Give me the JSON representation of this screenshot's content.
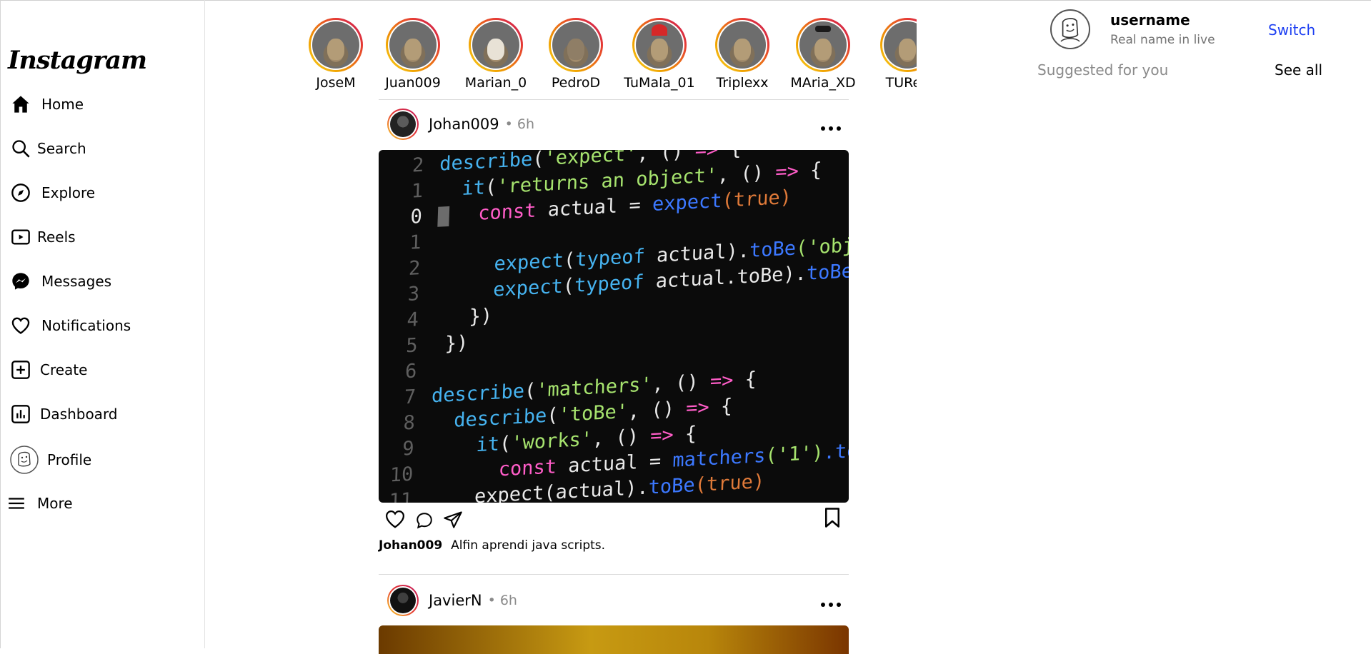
{
  "brand": {
    "logo": "Instagram"
  },
  "sidebar": {
    "items": [
      {
        "label": "Home",
        "icon": "home-icon"
      },
      {
        "label": "Search",
        "icon": "search-icon"
      },
      {
        "label": "Explore",
        "icon": "compass-icon"
      },
      {
        "label": "Reels",
        "icon": "reels-icon"
      },
      {
        "label": "Messages",
        "icon": "messenger-icon"
      },
      {
        "label": "Notifications",
        "icon": "heart-icon"
      },
      {
        "label": "Create",
        "icon": "plus-square-icon"
      },
      {
        "label": "Dashboard",
        "icon": "bar-chart-icon"
      },
      {
        "label": "Profile",
        "icon": "avatar-icon"
      },
      {
        "label": "More",
        "icon": "menu-icon"
      }
    ]
  },
  "stories": [
    {
      "name": "JoseM"
    },
    {
      "name": "Juan009"
    },
    {
      "name": "Marian_0"
    },
    {
      "name": "PedroD"
    },
    {
      "name": "TuMala_01"
    },
    {
      "name": "Triplexx"
    },
    {
      "name": "MAria_XD"
    },
    {
      "name": "TURey"
    }
  ],
  "posts": [
    {
      "user": "Johan009",
      "time": "• 6h",
      "caption_user": "Johan009",
      "caption": "Alfin aprendi java scripts."
    },
    {
      "user": "JavierN",
      "time": "• 6h"
    }
  ],
  "right": {
    "username": "username",
    "realname": "Real name in live",
    "switch": "Switch",
    "suggested": "Suggested for you",
    "see_all": "See all"
  },
  "colors": {
    "accent_link": "#1d3ff2",
    "muted": "#737373",
    "story_ring": "#e53935"
  }
}
